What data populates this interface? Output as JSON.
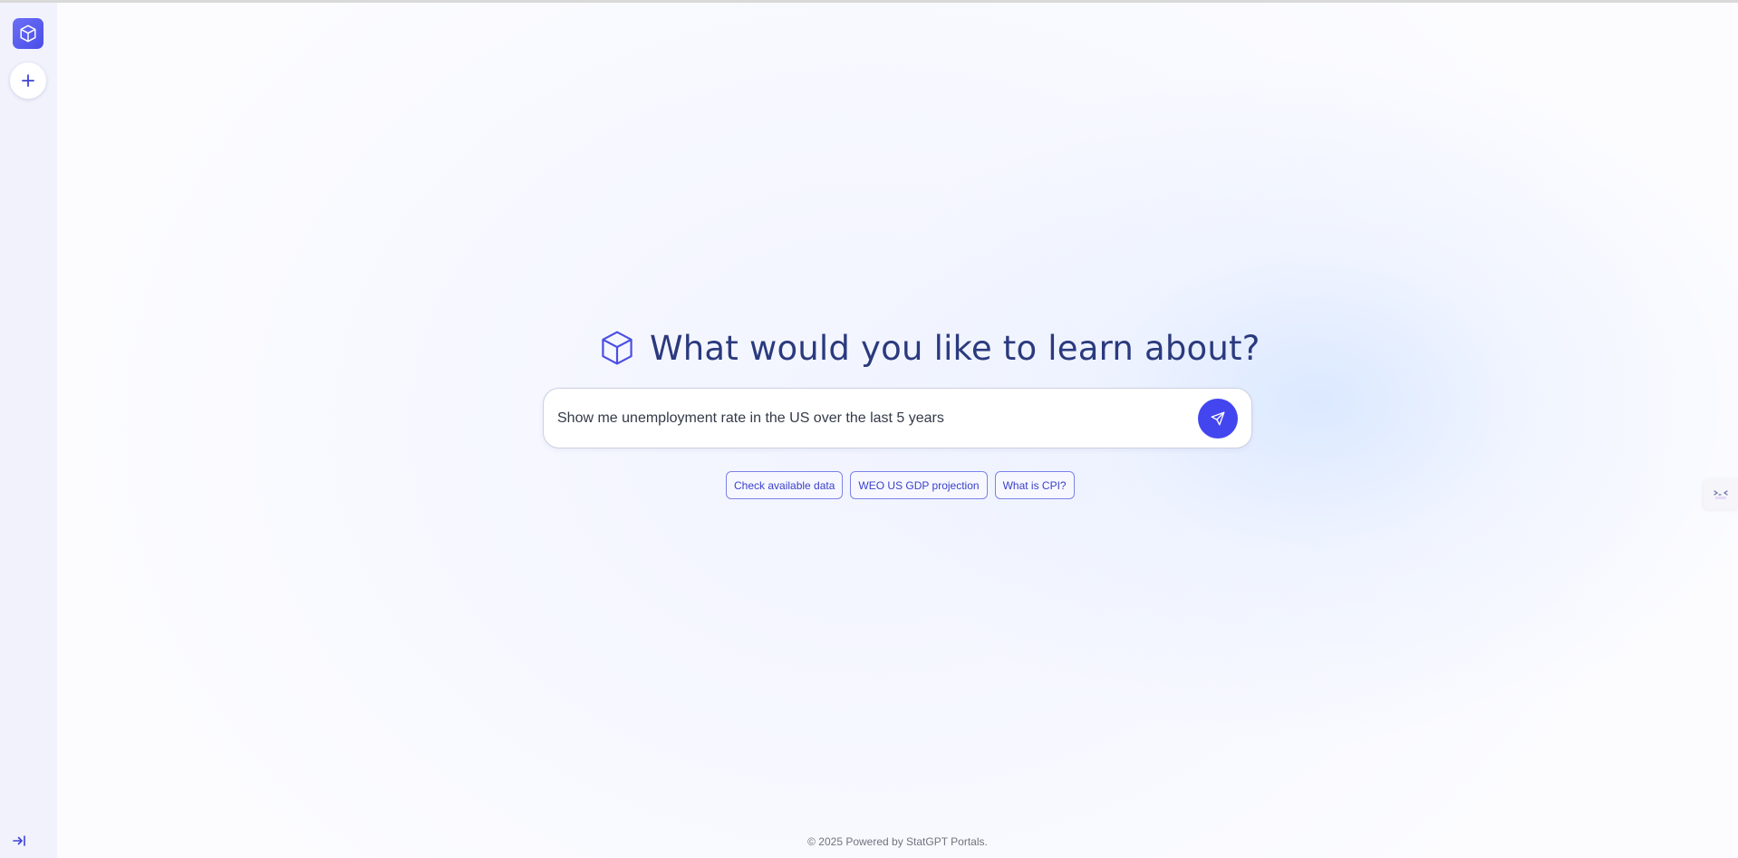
{
  "sidebar": {
    "logo_icon": "cube-icon",
    "new_chat_icon": "plus-icon",
    "collapse_icon": "expand-sidebar-icon"
  },
  "main": {
    "headline": "What would you like to learn about?",
    "headline_icon": "cube-outline-icon",
    "search": {
      "value": "Show me unemployment rate in the US over the last 5 years",
      "send_icon": "send-icon"
    },
    "suggestions": [
      "Check available data",
      "WEO US GDP projection",
      "What is CPI?"
    ],
    "footer": "© 2025 Powered by StatGPT Portals."
  },
  "right_panel_toggle_icon": "panel-toggle-icon",
  "colors": {
    "accent": "#4346ef",
    "headline": "#2b3a7e",
    "sidebar_bg": "#f1f2fc"
  }
}
